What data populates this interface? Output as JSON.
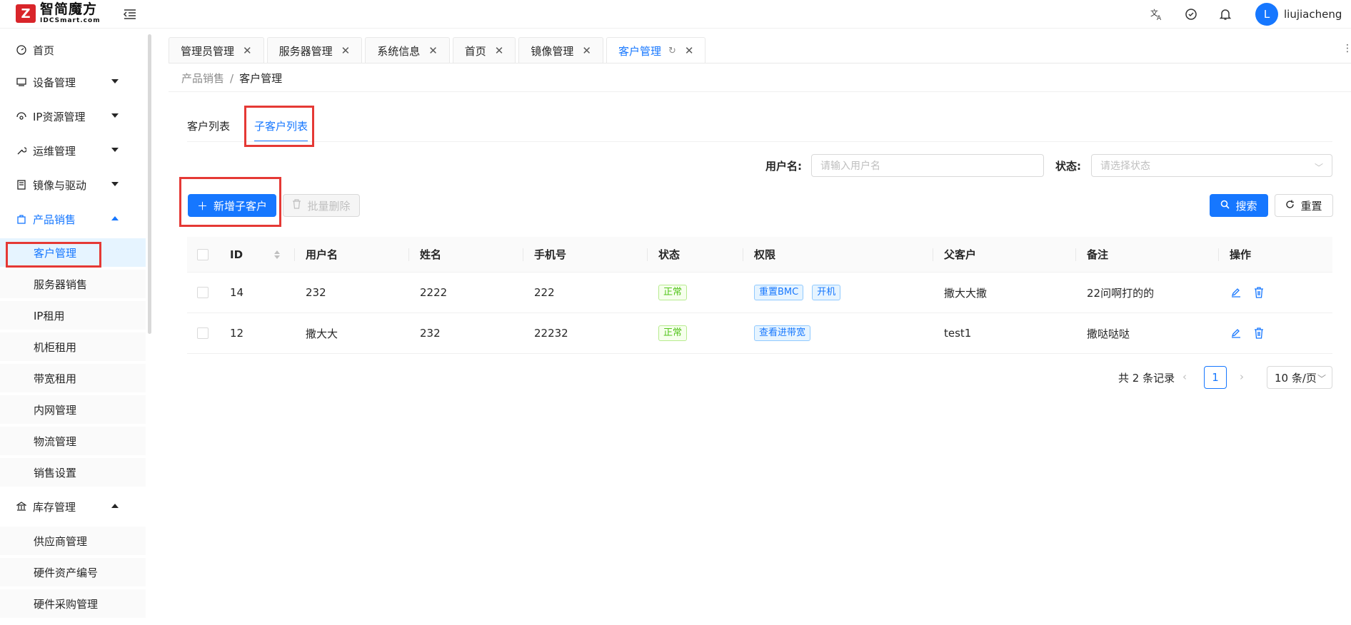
{
  "logo": {
    "mark": "Z",
    "name_cn": "智简魔方",
    "name_en": "IDCSmart.com"
  },
  "header": {
    "user_initial": "L",
    "username": "liujiacheng"
  },
  "sidebar": {
    "items": [
      {
        "label": "首页",
        "icon": "dashboard-icon"
      },
      {
        "label": "设备管理",
        "icon": "monitor-icon"
      },
      {
        "label": "IP资源管理",
        "icon": "network-icon"
      },
      {
        "label": "运维管理",
        "icon": "wrench-icon"
      },
      {
        "label": "镜像与驱动",
        "icon": "book-icon"
      },
      {
        "label": "产品销售",
        "icon": "bag-icon"
      },
      {
        "label": "库存管理",
        "icon": "bank-icon"
      }
    ],
    "product_sub": [
      "客户管理",
      "服务器销售",
      "IP租用",
      "机柜租用",
      "带宽租用",
      "内网管理",
      "物流管理",
      "销售设置"
    ],
    "stock_sub": [
      "供应商管理",
      "硬件资产编号",
      "硬件采购管理"
    ]
  },
  "tabs": [
    {
      "label": "管理员管理"
    },
    {
      "label": "服务器管理"
    },
    {
      "label": "系统信息"
    },
    {
      "label": "首页"
    },
    {
      "label": "镜像管理"
    },
    {
      "label": "客户管理"
    }
  ],
  "breadcrumb": {
    "parent": "产品销售",
    "sep": "/",
    "current": "客户管理"
  },
  "content_tabs": [
    "客户列表",
    "子客户列表"
  ],
  "filters": {
    "username_label": "用户名:",
    "username_placeholder": "请输入用户名",
    "status_label": "状态:",
    "status_placeholder": "请选择状态"
  },
  "toolbar": {
    "add_label": "新增子客户",
    "batch_delete_label": "批量删除",
    "search_label": "搜索",
    "reset_label": "重置"
  },
  "table": {
    "columns": [
      "ID",
      "用户名",
      "姓名",
      "手机号",
      "状态",
      "权限",
      "父客户",
      "备注",
      "操作"
    ],
    "rows": [
      {
        "id": "14",
        "username": "232",
        "name": "2222",
        "phone": "222",
        "status": "正常",
        "perms": [
          "重置BMC",
          "开机"
        ],
        "parent": "撒大大撒",
        "remark": "22问啊打的的"
      },
      {
        "id": "12",
        "username": "撒大大",
        "name": "232",
        "phone": "22232",
        "status": "正常",
        "perms": [
          "查看进带宽"
        ],
        "parent": "test1",
        "remark": "撒哒哒哒"
      }
    ]
  },
  "pagination": {
    "total_text": "共 2 条记录",
    "current_page": "1",
    "page_size": "10 条/页"
  },
  "colors": {
    "primary": "#1677ff",
    "highlight_box": "#e53935",
    "success": "#52c41a"
  }
}
